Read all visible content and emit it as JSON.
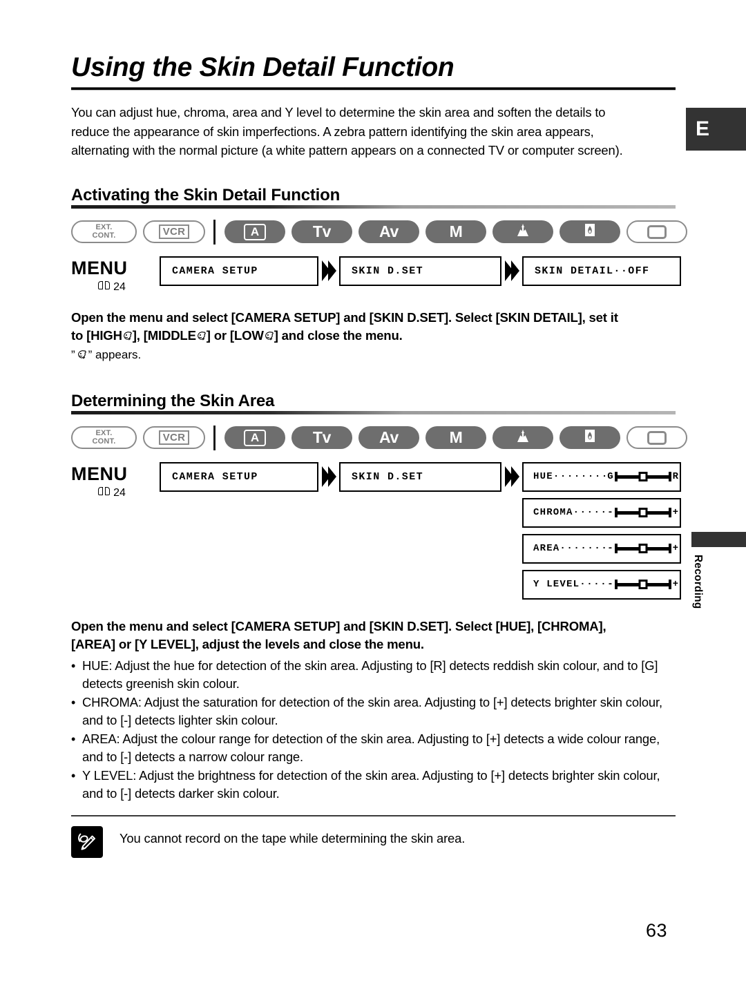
{
  "document": {
    "title": "Using the Skin Detail Function",
    "page_number": "63",
    "language_tab": "E",
    "side_tab": "Recording"
  },
  "intro": {
    "line1": "You can adjust hue, chroma, area and Y level to determine the skin area and soften the details to",
    "line2": "reduce the appearance of skin imperfections. A zebra pattern identifying the skin area appears,",
    "line3": "alternating with the normal picture (a white pattern appears on a connected TV or computer screen)."
  },
  "mode_bar": {
    "ext_cont_line1": "EXT.",
    "ext_cont_line2": "CONT.",
    "vcr": "VCR",
    "modes": [
      {
        "label": "A",
        "style": "boxed",
        "active": true
      },
      {
        "label": "Tv",
        "style": "text",
        "active": true
      },
      {
        "label": "Av",
        "style": "text",
        "active": true
      },
      {
        "label": "M",
        "style": "text",
        "active": true
      },
      {
        "label": "spotlight-icon",
        "style": "icon",
        "active": true
      },
      {
        "label": "night-icon",
        "style": "icon",
        "active": true
      },
      {
        "label": "card-icon",
        "style": "card",
        "active": false
      }
    ]
  },
  "menu": {
    "word": "MENU",
    "ref_page": "24"
  },
  "section1": {
    "heading": "Activating the Skin Detail Function",
    "flow": [
      "CAMERA SETUP",
      "SKIN D.SET",
      "SKIN DETAIL··OFF"
    ],
    "instruction_line1": "Open the menu and select [CAMERA SETUP] and [SKIN D.SET]. Select [SKIN DETAIL], set it",
    "instruction_line2_a": "to [HIGH",
    "instruction_line2_b": "], [MIDDLE",
    "instruction_line2_c": "] or [LOW",
    "instruction_line2_d": "] and close the menu.",
    "appears_prefix": "”",
    "appears_suffix": "” appears."
  },
  "section2": {
    "heading": "Determining the Skin Area",
    "flow": [
      "CAMERA SETUP",
      "SKIN D.SET"
    ],
    "sliders": [
      {
        "name": "HUE",
        "dots": "··········",
        "min": "G",
        "max": "R",
        "value": 50
      },
      {
        "name": "CHROMA",
        "dots": "·······",
        "min": "-",
        "max": "+",
        "value": 50
      },
      {
        "name": "AREA",
        "dots": "·········",
        "min": "-",
        "max": "+",
        "value": 50
      },
      {
        "name": "Y LEVEL",
        "dots": "······",
        "min": "-",
        "max": "+",
        "value": 50
      }
    ],
    "instruction_line1": "Open the menu and select [CAMERA SETUP] and [SKIN D.SET]. Select [HUE], [CHROMA],",
    "instruction_line2": "[AREA] or [Y LEVEL], adjust the levels and close the menu.",
    "bullets": [
      {
        "marker": "•",
        "line1": "HUE: Adjust the hue for detection of the skin area. Adjusting to [R] detects reddish skin colour, and to [G]",
        "line2": "detects greenish skin colour."
      },
      {
        "marker": "•",
        "line1": "CHROMA: Adjust the saturation for detection of the skin area. Adjusting to [+] detects brighter skin colour,",
        "line2": "and to [-] detects lighter skin colour."
      },
      {
        "marker": "•",
        "line1": "AREA: Adjust the colour range for detection of the skin area. Adjusting to [+] detects a wide colour range,",
        "line2": "and to [-] detects a narrow colour range."
      },
      {
        "marker": "•",
        "line1": "Y LEVEL: Adjust the brightness for detection of the skin area. Adjusting to [+] detects brighter skin colour,",
        "line2": "and to [-] detects darker skin colour."
      }
    ]
  },
  "note": {
    "icon": "memo-pencil-icon",
    "text": "You cannot record on the tape while determining the skin area."
  },
  "colors": {
    "mode_fill": "#6e6e6e",
    "mode_outline": "#8b8b8b",
    "tab_dark": "#333333",
    "rule_dark": "#1a1a1a",
    "rule_light": "#b5b5b5"
  }
}
